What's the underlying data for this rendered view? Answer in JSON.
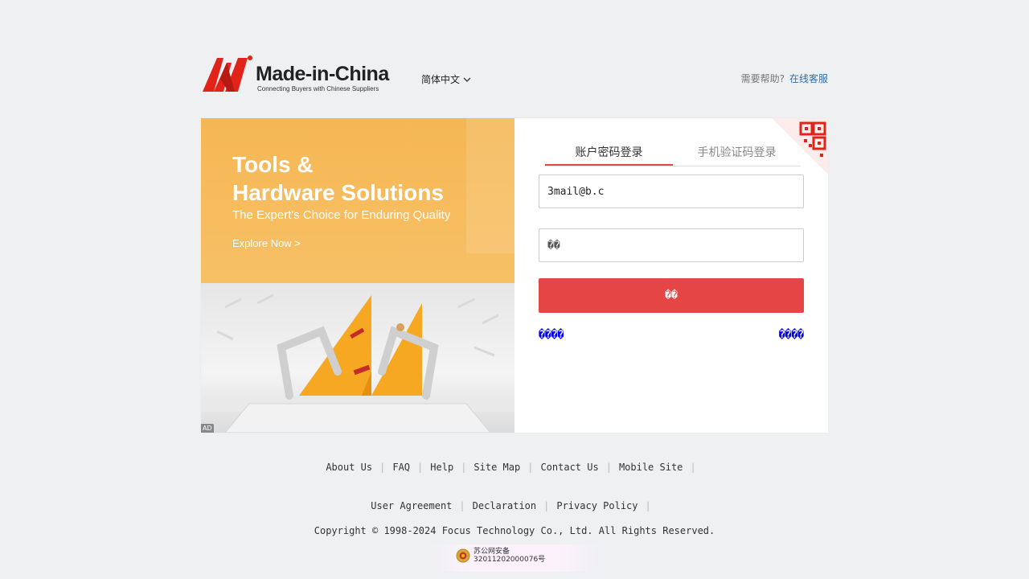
{
  "header": {
    "logo_text": "Made-in-China",
    "logo_tagline": "Connecting Buyers with Chinese Suppliers",
    "language": "简体中文",
    "help_label": "需要帮助?",
    "help_link": "在线客服"
  },
  "banner": {
    "title": "Tools &\nHardware Solutions",
    "subtitle": "The Expert's Choice for Enduring Quality",
    "cta": "Explore Now  >",
    "ad_label": "AD",
    "colors": {
      "top": "#f5b755",
      "accent": "#f7a823"
    }
  },
  "login": {
    "tabs": [
      {
        "label": "账户密码登录",
        "active": true
      },
      {
        "label": "手机验证码登录",
        "active": false
      }
    ],
    "email_value": "3mail@b.c",
    "password_placeholder": "��",
    "submit_label": "��",
    "link_left": "����",
    "link_right": "����",
    "accent_color": "#e64545"
  },
  "footer": {
    "row1": [
      "About Us",
      "FAQ",
      "Help",
      "Site Map",
      "Contact Us",
      "Mobile Site"
    ],
    "row2": [
      "User Agreement",
      "Declaration",
      "Privacy Policy"
    ],
    "copyright": "Copyright © 1998-2024 Focus Technology Co., Ltd. All Rights Reserved.",
    "police_line1": "苏公网安备",
    "police_line2": "32011202000076号"
  }
}
